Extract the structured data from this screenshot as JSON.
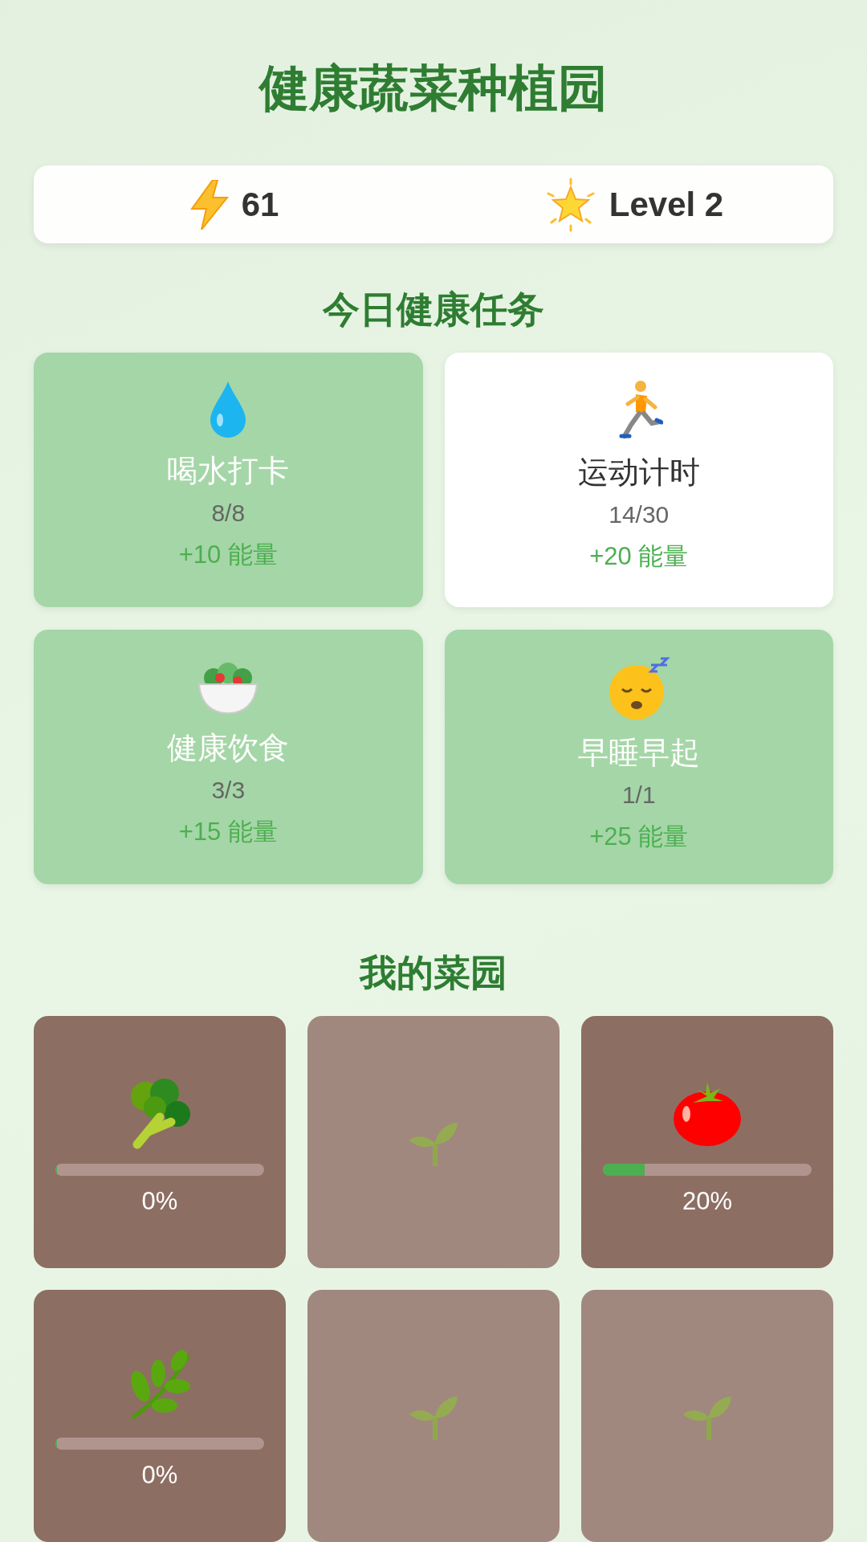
{
  "title": "健康蔬菜种植园",
  "stats": {
    "energy": "61",
    "level": "Level 2"
  },
  "tasks_title": "今日健康任务",
  "tasks": [
    {
      "name": "喝水打卡",
      "progress": "8/8",
      "reward": "+10 能量",
      "completed": true
    },
    {
      "name": "运动计时",
      "progress": "14/30",
      "reward": "+20 能量",
      "completed": false
    },
    {
      "name": "健康饮食",
      "progress": "3/3",
      "reward": "+15 能量",
      "completed": true
    },
    {
      "name": "早睡早起",
      "progress": "1/1",
      "reward": "+25 能量",
      "completed": true
    }
  ],
  "garden_title": "我的菜园",
  "plots": [
    {
      "kind": "crop",
      "level": 0,
      "reading": "0%"
    },
    {
      "kind": "empty"
    },
    {
      "kind": "crop",
      "level": 0.2,
      "reading": "20%"
    },
    {
      "kind": "crop",
      "level": 0,
      "reading": "0%"
    },
    {
      "kind": "empty"
    },
    {
      "kind": "empty"
    }
  ]
}
